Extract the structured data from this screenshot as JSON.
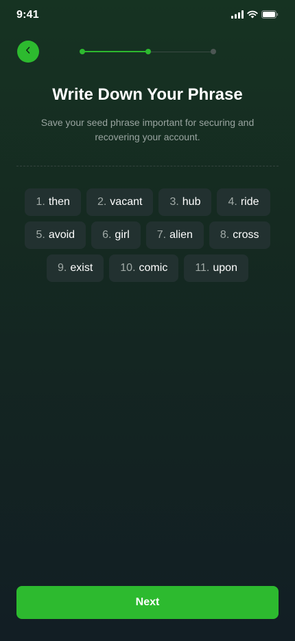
{
  "status_bar": {
    "time": "9:41",
    "icons": [
      "cellular-signal-icon",
      "wifi-icon",
      "battery-icon"
    ]
  },
  "header": {
    "back_icon": "chevron-left-icon",
    "progress": {
      "total_steps": 3,
      "current_step": 2
    }
  },
  "title": "Write Down Your Phrase",
  "subtitle": "Save your seed phrase important for securing and recovering your account.",
  "phrase": [
    {
      "num": "1.",
      "word": "then"
    },
    {
      "num": "2.",
      "word": "vacant"
    },
    {
      "num": "3.",
      "word": "hub"
    },
    {
      "num": "4.",
      "word": "ride"
    },
    {
      "num": "5.",
      "word": "avoid"
    },
    {
      "num": "6.",
      "word": "girl"
    },
    {
      "num": "7.",
      "word": "alien"
    },
    {
      "num": "8.",
      "word": "cross"
    },
    {
      "num": "9.",
      "word": "exist"
    },
    {
      "num": "10.",
      "word": "comic"
    },
    {
      "num": "11.",
      "word": "upon"
    }
  ],
  "next_label": "Next",
  "colors": {
    "accent": "#2dba2f",
    "chip_background": "#223130",
    "muted_text": "#9aa5a1"
  }
}
